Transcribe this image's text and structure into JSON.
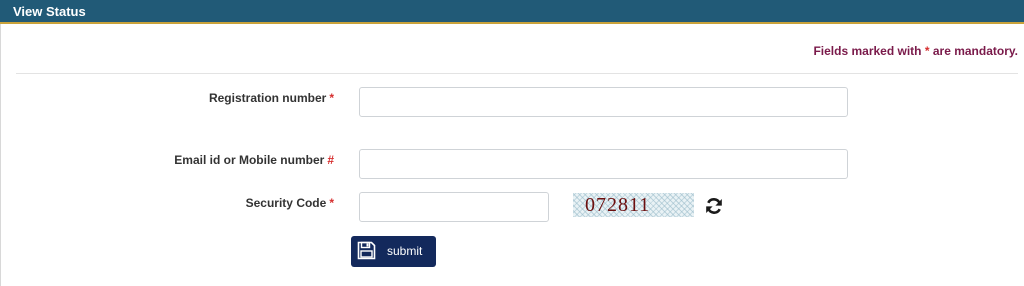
{
  "header": {
    "title": "View Status"
  },
  "notice": {
    "prefix": "Fields marked with ",
    "star": "*",
    "suffix": " are mandatory."
  },
  "form": {
    "registration": {
      "label": "Registration number",
      "marker": "*",
      "value": "",
      "placeholder": ""
    },
    "contact": {
      "label": "Email id or Mobile number",
      "marker": "#",
      "value": "",
      "placeholder": ""
    },
    "security": {
      "label": "Security Code",
      "marker": "*",
      "value": "",
      "placeholder": ""
    },
    "captcha": {
      "code": "072811"
    },
    "refresh_icon": "refresh-icon",
    "submit": {
      "label": "submit",
      "icon": "save-icon"
    }
  },
  "colors": {
    "header_bg": "#215a77",
    "notice_text": "#7a1a4a",
    "required_marker": "#d62f2f",
    "submit_bg": "#13295c",
    "captcha_text": "#6b0f0f"
  }
}
